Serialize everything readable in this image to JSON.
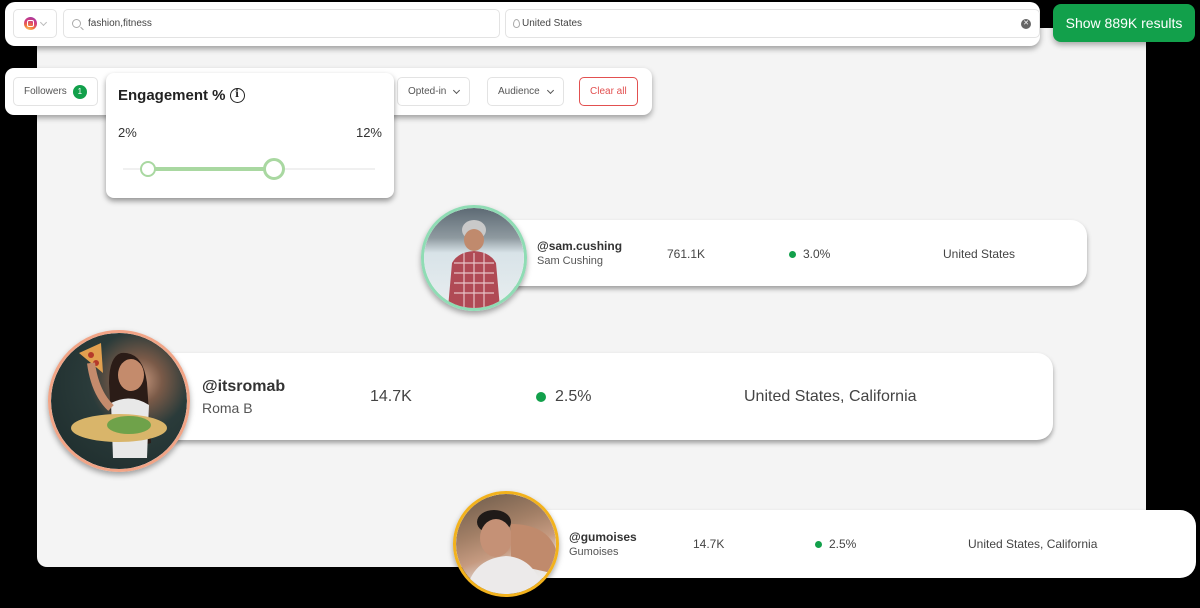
{
  "search": {
    "platform": "Instagram",
    "platform_icon": "instagram-icon",
    "keywords_value": "fashion,fitness",
    "location_value": "United States",
    "show_results_label": "Show 889K results"
  },
  "filters": {
    "chips": [
      {
        "label": "Followers",
        "badge": "1"
      },
      {
        "label": "Opted-in"
      },
      {
        "label": "Audience"
      }
    ],
    "clear_all_label": "Clear all"
  },
  "engagement_popover": {
    "title": "Engagement %",
    "info_icon": "i",
    "min_label": "2%",
    "max_label": "12%",
    "selected_low_fraction": 0.1,
    "selected_high_fraction": 0.6
  },
  "creators": [
    {
      "handle": "@sam.cushing",
      "name": "Sam Cushing",
      "followers": "761.1K",
      "engagement": "3.0%",
      "location": "United States",
      "ring_color": "#8fdcb4"
    },
    {
      "handle": "@itsromab",
      "name": "Roma B",
      "followers": "14.7K",
      "engagement": "2.5%",
      "location": "United States, California",
      "ring_color": "#f1a486"
    },
    {
      "handle": "@gumoises",
      "name": "Gumoises",
      "followers": "14.7K",
      "engagement": "2.5%",
      "location": "United States, California",
      "ring_color": "#f2b21d"
    }
  ],
  "colors": {
    "accent_green": "#12a04b",
    "slider_green": "#a9d8a1",
    "clear_red": "#e25050"
  }
}
